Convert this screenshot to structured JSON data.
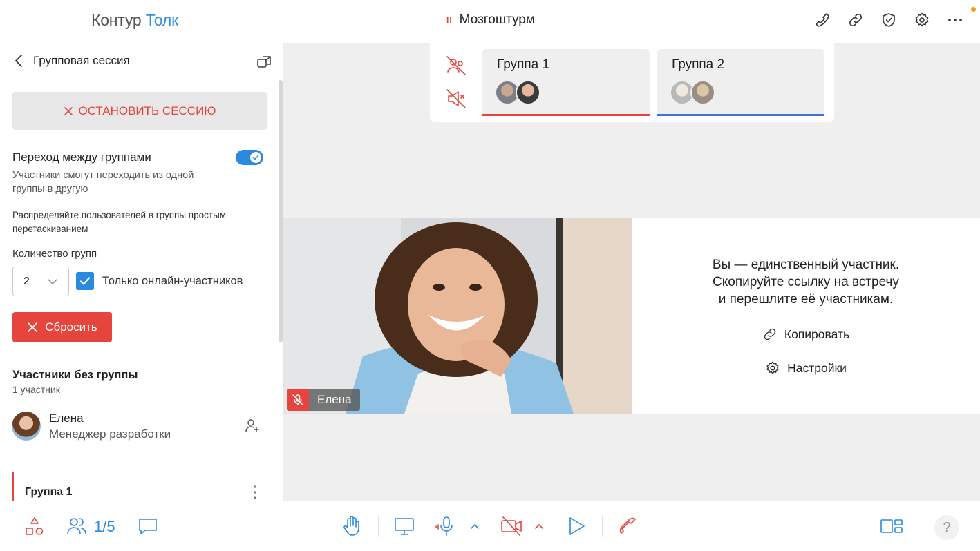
{
  "header": {
    "logo_part1": "Контур",
    "logo_part2": "Толк",
    "meeting_indicator": "II",
    "meeting_title": "Мозгоштурм",
    "icons": [
      "phone-icon",
      "link-icon",
      "shield-icon",
      "gear-icon",
      "more-icon"
    ]
  },
  "sidebar": {
    "title": "Групповая сессия",
    "stop_button": "ОСТАНОВИТЬ СЕССИЮ",
    "toggle_title": "Переход между группами",
    "toggle_on": true,
    "toggle_desc": "Участники смогут переходить из одной группы в другую",
    "drag_hint": "Распределяйте пользователей в группы простым перетаскиванием",
    "groups_count_label": "Количество групп",
    "groups_count_value": "2",
    "online_only_checked": true,
    "online_only_label": "Только онлайн-участников",
    "reset_button": "Сбросить",
    "ungrouped_title": "Участники без группы",
    "ungrouped_count": "1 участник",
    "participants": [
      {
        "name": "Елена",
        "role": "Менеджер разработки"
      }
    ],
    "group_items": [
      {
        "label": "Группа 1"
      }
    ]
  },
  "main": {
    "groups": [
      {
        "name": "Группа 1",
        "color": "#e6453d"
      },
      {
        "name": "Группа 2",
        "color": "#3d73d6"
      }
    ],
    "video_name": "Елена",
    "invite_lines": [
      "Вы — единственный участник.",
      "Скопируйте ссылку на встречу",
      "и перешлите её участникам."
    ],
    "copy_label": "Копировать",
    "settings_label": "Настройки"
  },
  "toolbar": {
    "participants_count": "1/5",
    "help_label": "?",
    "accent": "#2a8ae0",
    "danger": "#e6453d"
  }
}
